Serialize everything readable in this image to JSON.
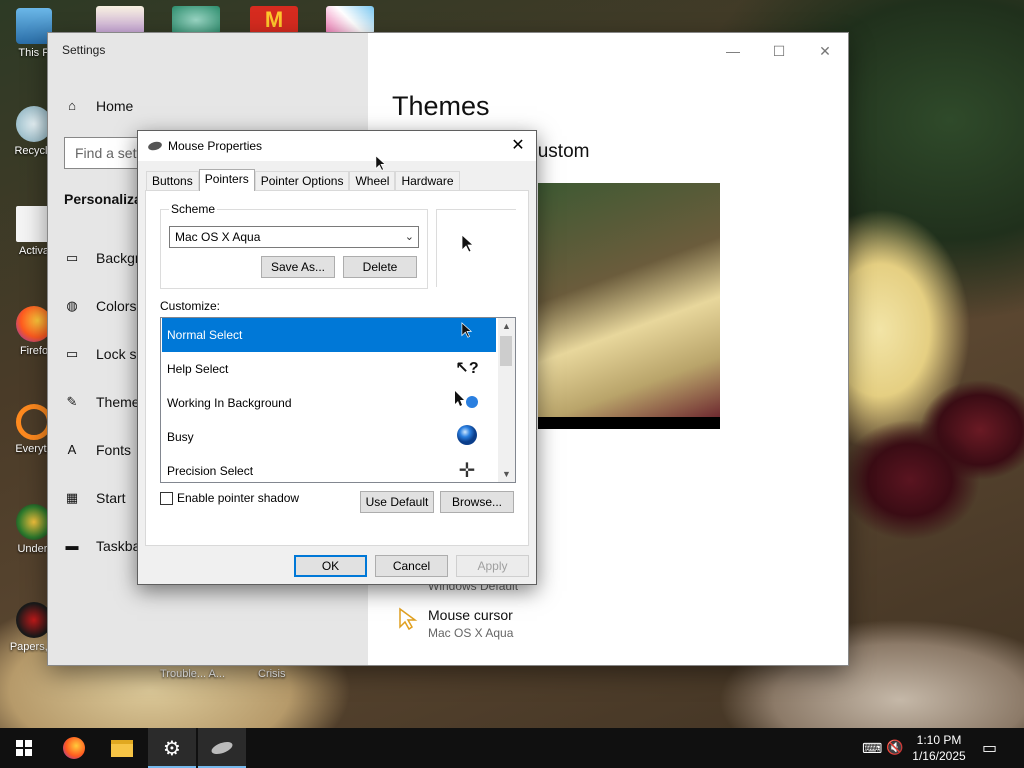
{
  "desktop": {
    "icons": [
      {
        "label": "This P"
      },
      {
        "label": "Recycle"
      },
      {
        "label": "Activa"
      },
      {
        "label": "Firefo"
      },
      {
        "label": "Everyth"
      },
      {
        "label": "Undert"
      },
      {
        "label": "Papers, P"
      }
    ],
    "bottom_labels": [
      "Trouble... A...",
      "Crisis"
    ]
  },
  "settings": {
    "window_title": "Settings",
    "home": "Home",
    "search_placeholder": "Find a setting",
    "section": "Personalization",
    "nav": [
      "Background",
      "Colors",
      "Lock screen",
      "Themes",
      "Fonts",
      "Start",
      "Taskbar"
    ],
    "page_title": "Themes",
    "current_theme": "Current theme: Custom",
    "windows_default": "Windows Default",
    "mouse_cursor_label": "Mouse cursor",
    "mouse_cursor_value": "Mac OS X Aqua"
  },
  "dialog": {
    "title": "Mouse Properties",
    "tabs": [
      "Buttons",
      "Pointers",
      "Pointer Options",
      "Wheel",
      "Hardware"
    ],
    "active_tab": "Pointers",
    "scheme_label": "Scheme",
    "scheme_value": "Mac OS X Aqua",
    "save_as": "Save As...",
    "delete": "Delete",
    "customize_label": "Customize:",
    "pointers": [
      {
        "name": "Normal Select",
        "icon": "arrow-pointer-icon",
        "selected": true
      },
      {
        "name": "Help Select",
        "icon": "help-pointer-icon",
        "selected": false
      },
      {
        "name": "Working In Background",
        "icon": "working-pointer-icon",
        "selected": false
      },
      {
        "name": "Busy",
        "icon": "busy-pointer-icon",
        "selected": false
      },
      {
        "name": "Precision Select",
        "icon": "crosshair-pointer-icon",
        "selected": false
      }
    ],
    "enable_shadow": "Enable pointer shadow",
    "use_default": "Use Default",
    "browse": "Browse...",
    "ok": "OK",
    "cancel": "Cancel",
    "apply": "Apply"
  },
  "taskbar": {
    "time": "1:10 PM",
    "date": "1/16/2025"
  },
  "colors": {
    "accent": "#0078d7",
    "taskbar": "#101010",
    "settings_sidebar": "#e6e6e6"
  }
}
